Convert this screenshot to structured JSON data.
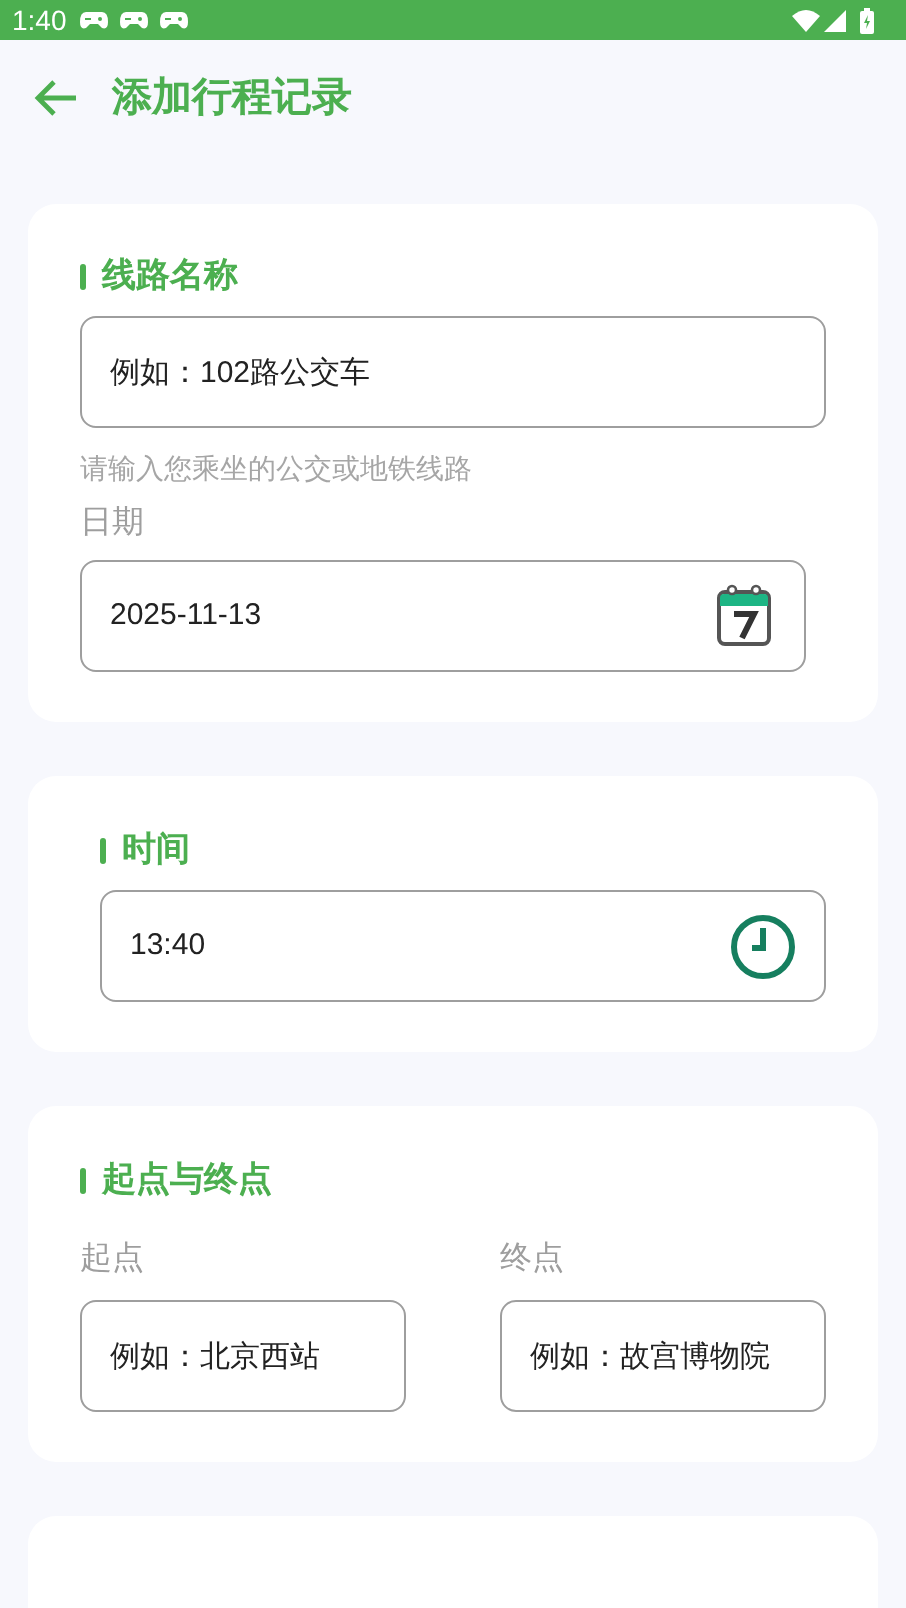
{
  "status_bar": {
    "time": "1:40"
  },
  "header": {
    "title": "添加行程记录"
  },
  "route_card": {
    "title": "线路名称",
    "route_field": {
      "placeholder": "例如：102路公交车"
    },
    "helper": "请输入您乘坐的公交或地铁线路",
    "date_label": "日期",
    "date_field": {
      "value": "2025-11-13"
    }
  },
  "time_card": {
    "title": "时间",
    "time_field": {
      "value": "13:40"
    }
  },
  "stops_card": {
    "title": "起点与终点",
    "stops": [
      {
        "label": "起点",
        "placeholder": "例如：北京西站"
      },
      {
        "label": "终点",
        "placeholder": "例如：故宫博物院"
      }
    ]
  }
}
